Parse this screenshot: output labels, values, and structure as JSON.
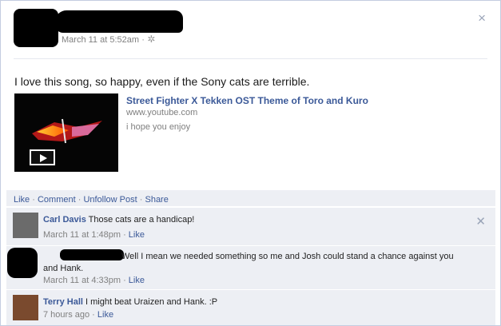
{
  "post": {
    "timestamp": "March 11 at 5:52am",
    "close_icon": "×",
    "status": "I love this song, so happy, even if the Sony cats are terrible."
  },
  "link": {
    "title": "Street Fighter X Tekken OST Theme of Toro and Kuro",
    "domain": "www.youtube.com",
    "description": "i hope you enjoy"
  },
  "actions": {
    "like": "Like",
    "comment": "Comment",
    "unfollow": "Unfollow Post",
    "share": "Share"
  },
  "comments": [
    {
      "name": "Carl Davis",
      "text": "Those cats are a handicap!",
      "time": "March 11 at 1:48pm",
      "like": "Like"
    },
    {
      "name": "",
      "text": "Well I mean we needed something so me and Josh could stand a chance against you and Hank.",
      "time": "March 11 at 4:33pm",
      "like": "Like"
    },
    {
      "name": "Terry Hall",
      "text": "I might beat Uraizen and Hank. :P",
      "time": "7 hours ago",
      "like": "Like"
    }
  ],
  "colors": {
    "link": "#3b5998",
    "comment_bg": "#edeff4",
    "meta": "#7f7f7f"
  }
}
